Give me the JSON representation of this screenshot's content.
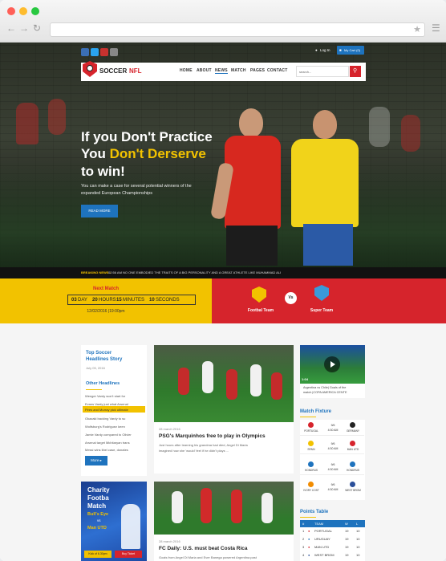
{
  "site": {
    "logo_text": "SOCCER",
    "logo_accent": "NFL",
    "login": "Log In",
    "cart": "My Cart (0)",
    "search_placeholder": "search...",
    "nav": [
      "HOME",
      "ABOUT",
      "NEWS",
      "MATCH",
      "PAGES",
      "CONTACT"
    ]
  },
  "hero": {
    "line1": "If you Don't Practice",
    "line2_prefix": "You ",
    "line2_accent": "Don't Derserve",
    "line3": "to win!",
    "subtext_1": "You can make a case for several potential winners of the",
    "subtext_2": "expanded European Championships",
    "button": "READ MORE"
  },
  "breaking": {
    "label": "BREAKING NEWS :",
    "text": "02:56 AM NO ONE EMBODIED THE TRAITS OF A BIG PERSONALITY AND A GREAT ATHLETE LIKE MUHAMMAD ALI"
  },
  "next_match": {
    "title": "Next Match",
    "days": "03",
    "days_label": "DAY",
    "hours": "20",
    "hours_label": "HOURS",
    "minutes": "15",
    "minutes_label": "MINUTES",
    "seconds": "10",
    "seconds_label": "SECONDS",
    "datetime": "12/02/2016 |19:00pm",
    "team_a": "Footbal Team",
    "vs": "Vs",
    "team_b": "Super Team"
  },
  "sidebar": {
    "top_story_title": "Top Soccer Headlines Story",
    "top_story_date": "July 05, 2016",
    "other_title": "Other Headlines",
    "headlines": [
      "Wenger Vardy won't start for",
      "Evans Vardy just what Arsenal",
      "Pires and Murray pick ultimate",
      "Okazaki backing Vardy to su",
      "Wolfsburg's Rodriguez keen",
      "Jamie Vardy compared to Olivier",
      "Arsenal target Mkhitaryan trans",
      "Messi wins libel case, donates"
    ],
    "more": "More",
    "ad_title_1": "Charity",
    "ad_title_2": "Footba",
    "ad_title_3": "Match",
    "ad_team1": "Bull's Eye",
    "ad_vs": "vs",
    "ad_team2": "Man UTD",
    "ad_kickoff": "Kick of 6.30pm",
    "ad_buy": "Buy Ticket"
  },
  "articles": [
    {
      "date": "28 march 2016",
      "title": "PSG's Marquinhos free to play in Olympics",
      "excerpt_1": "Just hours after learning his grandma had died, Angel Di Maria",
      "excerpt_2": "imagined how she 'would' feel if he didn't plays ..."
    },
    {
      "date": "28 march 2016",
      "title": "FC Daily: U.S. must beat Costa Rica",
      "excerpt_1": "Goals from Angel Di Maria and Ever Banega powered Argentina past"
    }
  ],
  "video": {
    "duration": "1:04",
    "caption_1": "Argentina vs Chile| Goals of the",
    "caption_2": "match |COPA AMERICA CENTE"
  },
  "fixture": {
    "title": "Match Fixture",
    "rows": [
      {
        "home": "PORTUGAL",
        "score": "9/6",
        "time": "4:30 AM",
        "away": "GERMANY"
      },
      {
        "home": "SPAIN",
        "score": "9/6",
        "time": "4:30 AM",
        "away": "MAN UTD"
      },
      {
        "home": "HONDRUS",
        "score": "9/6",
        "time": "4:30 AM",
        "away": "HONDRUS"
      },
      {
        "home": "IVORY COST",
        "score": "9/6",
        "time": "4:30 AM",
        "away": "WEST BROM"
      }
    ]
  },
  "points": {
    "title": "Points Table",
    "headers": [
      "#",
      "TEAM",
      "W",
      "L"
    ],
    "rows": [
      {
        "pos": "1",
        "team": "PORTUGAL",
        "w": "19",
        "l": "10"
      },
      {
        "pos": "2",
        "team": "URUGUAY",
        "w": "19",
        "l": "10"
      },
      {
        "pos": "3",
        "team": "MAN UTD",
        "w": "19",
        "l": "10"
      },
      {
        "pos": "4",
        "team": "WEST BROM",
        "w": "19",
        "l": "10"
      }
    ]
  },
  "colors": {
    "accent_yellow": "#f2c200",
    "accent_red": "#d6242c",
    "brand_blue": "#1e73be"
  }
}
